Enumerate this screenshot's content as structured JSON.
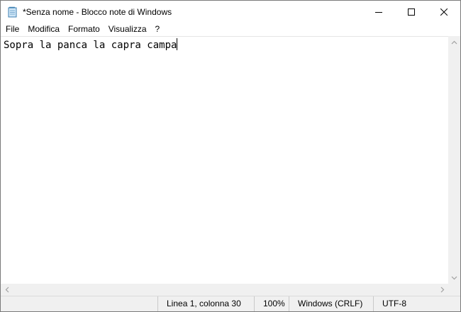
{
  "window": {
    "title": "*Senza nome - Blocco note di Windows",
    "icons": {
      "app": "notepad-icon",
      "minimize": "minimize-icon",
      "maximize": "maximize-icon",
      "close": "close-icon"
    }
  },
  "menu": {
    "items": [
      {
        "label": "File"
      },
      {
        "label": "Modifica"
      },
      {
        "label": "Formato"
      },
      {
        "label": "Visualizza"
      },
      {
        "label": "?"
      }
    ]
  },
  "editor": {
    "text": "Sopra la panca la capra campa"
  },
  "status": {
    "position": "Linea 1, colonna 30",
    "zoom": "100%",
    "line_ending": "Windows (CRLF)",
    "encoding": "UTF-8"
  },
  "colors": {
    "window_bg": "#ffffff",
    "chrome_bg": "#f0f0f0",
    "border": "#7a7a7a"
  }
}
